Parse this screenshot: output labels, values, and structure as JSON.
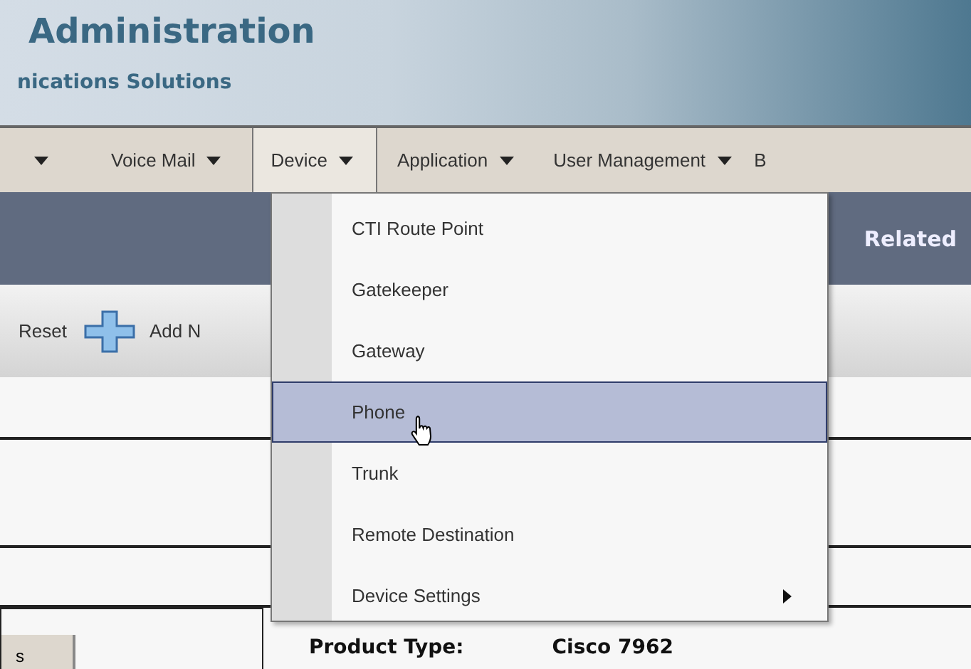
{
  "header": {
    "title": "Administration",
    "subtitle": "nications Solutions"
  },
  "menu_bar": [
    {
      "kind": "caret-only",
      "selected": false
    },
    {
      "kind": "menu",
      "label": "Voice Mail",
      "selected": false
    },
    {
      "kind": "menu",
      "label": "Device",
      "selected": true
    },
    {
      "kind": "menu",
      "label": "Application",
      "selected": false
    },
    {
      "kind": "menu",
      "label": "User Management",
      "selected": false
    },
    {
      "kind": "clipped",
      "label": "B",
      "selected": false
    }
  ],
  "title_bar": {
    "text": "Related"
  },
  "toolbar": [
    {
      "label": "Reset",
      "icon": false
    },
    {
      "label": "Add N",
      "icon": true
    }
  ],
  "device_menu": [
    {
      "label": "CTI Route Point",
      "selected": false,
      "has_submenu": false
    },
    {
      "label": "Gatekeeper",
      "selected": false,
      "has_submenu": false
    },
    {
      "label": "Gateway",
      "selected": false,
      "has_submenu": false
    },
    {
      "label": "Phone",
      "selected": true,
      "has_submenu": false
    },
    {
      "label": "Trunk",
      "selected": false,
      "has_submenu": false
    },
    {
      "label": "Remote Destination",
      "selected": false,
      "has_submenu": false
    },
    {
      "label": "Device Settings",
      "selected": false,
      "has_submenu": true
    }
  ],
  "left_tab": {
    "label": "s"
  },
  "product": {
    "label": "Product Type:",
    "value": "Cisco 7962"
  }
}
